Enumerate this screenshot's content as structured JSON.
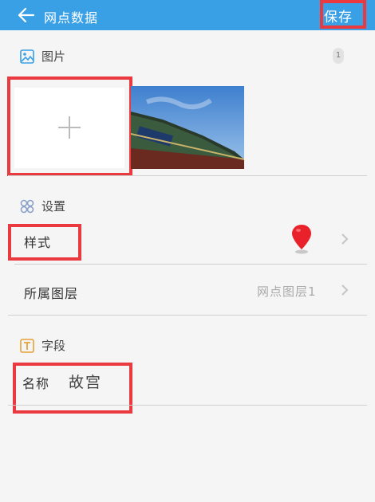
{
  "header": {
    "title": "网点数据",
    "save_label": "保存"
  },
  "images": {
    "section_title": "图片",
    "count": "1"
  },
  "settings": {
    "section_title": "设置",
    "style_label": "样式",
    "layer_label": "所属图层",
    "layer_value": "网点图层1"
  },
  "fields": {
    "section_title": "字段",
    "name_label": "名称",
    "name_value": "故宫"
  },
  "colors": {
    "accent": "#3aa0e6",
    "highlight": "#ea3a3f",
    "pin": "#e8212b"
  },
  "icons": [
    "back-arrow-icon",
    "image-icon",
    "plus-icon",
    "settings-grid-icon",
    "location-pin-icon",
    "chevron-right-icon",
    "text-field-icon"
  ]
}
